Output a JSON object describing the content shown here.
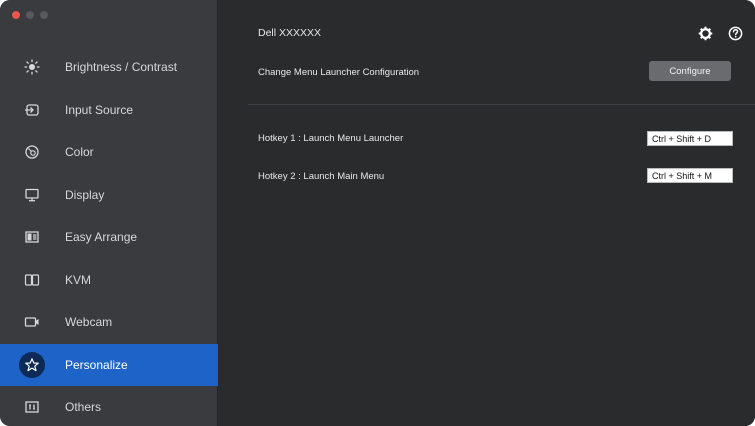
{
  "window": {
    "traffic_lights": [
      "close",
      "minimize",
      "maximize"
    ]
  },
  "sidebar": {
    "items": [
      {
        "label": "Brightness / Contrast",
        "icon": "brightness-icon",
        "active": false
      },
      {
        "label": "Input Source",
        "icon": "input-source-icon",
        "active": false
      },
      {
        "label": "Color",
        "icon": "color-icon",
        "active": false
      },
      {
        "label": "Display",
        "icon": "display-icon",
        "active": false
      },
      {
        "label": "Easy Arrange",
        "icon": "easy-arrange-icon",
        "active": false
      },
      {
        "label": "KVM",
        "icon": "kvm-icon",
        "active": false
      },
      {
        "label": "Webcam",
        "icon": "webcam-icon",
        "active": false
      },
      {
        "label": "Personalize",
        "icon": "star-icon",
        "active": true
      },
      {
        "label": "Others",
        "icon": "others-icon",
        "active": false
      }
    ],
    "active_color": "#1e64c8"
  },
  "main": {
    "title": "Dell XXXXXX",
    "header_icons": [
      "settings-icon",
      "help-icon"
    ],
    "menu_launcher": {
      "label": "Change Menu Launcher Configuration",
      "button_label": "Configure"
    },
    "hotkeys": [
      {
        "label": "Hotkey 1 : Launch Menu Launcher",
        "value": "Ctrl + Shift + D"
      },
      {
        "label": "Hotkey 2 : Launch Main Menu",
        "value": "Ctrl + Shift + M"
      }
    ]
  }
}
